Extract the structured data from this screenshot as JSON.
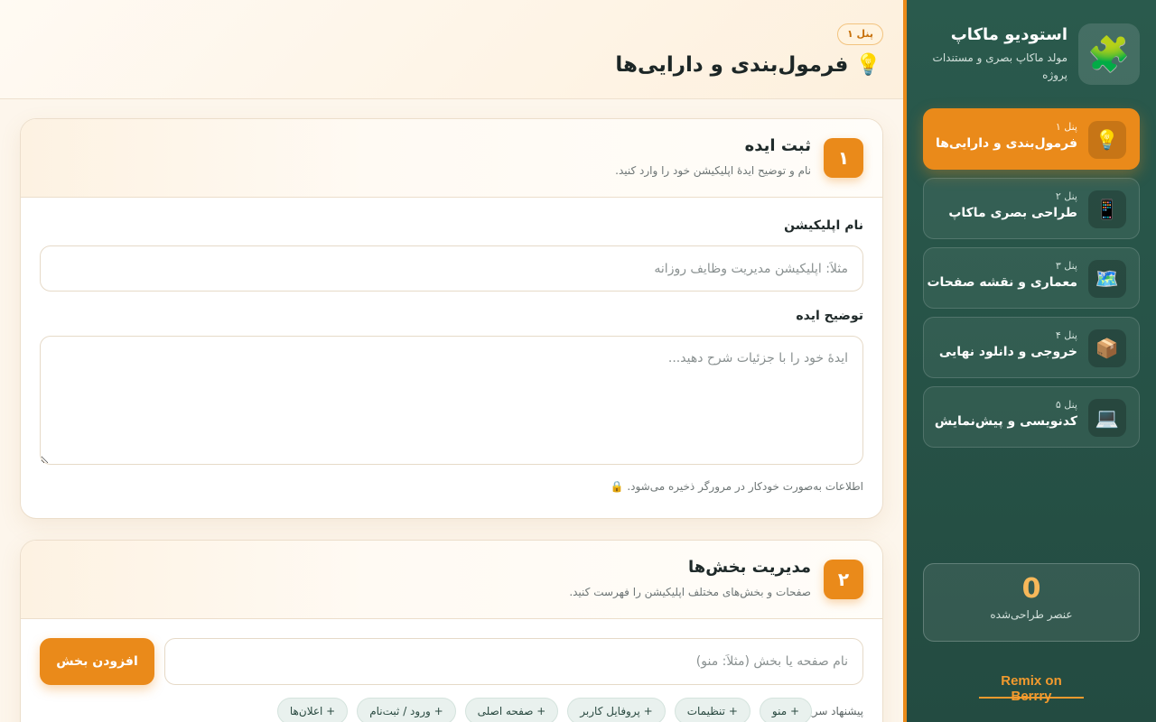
{
  "brand": {
    "icon": "puzzle-icon",
    "title": "استودیو ماکاپ",
    "subtitle": "مولد ماکاپ بصری و مستندات پروژه"
  },
  "nav": {
    "items": [
      {
        "icon": "lightbulb-icon",
        "glyph": "💡",
        "panel": "پنل ۱",
        "label": "فرمول‌بندی و دارایی‌ها",
        "active": true
      },
      {
        "icon": "mobile-phone-icon",
        "glyph": "📱",
        "panel": "پنل ۲",
        "label": "طراحی بصری ماکاپ",
        "active": false
      },
      {
        "icon": "map-icon",
        "glyph": "🗺️",
        "panel": "پنل ۳",
        "label": "معماری و نقشه صفحات",
        "active": false
      },
      {
        "icon": "package-icon",
        "glyph": "📦",
        "panel": "پنل ۴",
        "label": "خروجی و دانلود نهایی",
        "active": false
      },
      {
        "icon": "laptop-icon",
        "glyph": "💻",
        "panel": "پنل ۵",
        "label": "کدنویسی و پیش‌نمایش",
        "active": false
      }
    ]
  },
  "stats": {
    "value": "0",
    "label": "عنصر طراحی‌شده"
  },
  "remix_link": "Remix on Berrry",
  "header": {
    "badge": "پنل ۱",
    "title": "💡 فرمول‌بندی و دارایی‌ها"
  },
  "idea_card": {
    "number": "۱",
    "title": "ثبت ایده",
    "subtitle": "نام و توضیح ایدهٔ اپلیکیشن خود را وارد کنید.",
    "name_label": "نام اپلیکیشن",
    "name_placeholder": "مثلاً: اپلیکیشن مدیریت وظایف روزانه",
    "desc_label": "توضیح ایده",
    "desc_placeholder": "ایدهٔ خود را با جزئیات شرح دهید...",
    "autosave_note": "اطلاعات به‌صورت خودکار در مرورگر ذخیره می‌شود. 🔒"
  },
  "sections_card": {
    "number": "۲",
    "title": "مدیریت بخش‌ها",
    "subtitle": "صفحات و بخش‌های مختلف اپلیکیشن را فهرست کنید.",
    "input_placeholder": "نام صفحه یا بخش (مثلاً: منو)",
    "add_button": "افزودن بخش",
    "quick_label": "پیشنهاد سریع:",
    "suggestions": [
      "+ منو",
      "+ تنظیمات",
      "+ پروفایل کاربر",
      "+ صفحه اصلی",
      "+ ورود / ثبت‌نام",
      "+ اعلان‌ها"
    ]
  },
  "colors": {
    "accent": "#ea8a1a",
    "sidebar": "#2a5a4d",
    "background": "#fdf6ec"
  }
}
